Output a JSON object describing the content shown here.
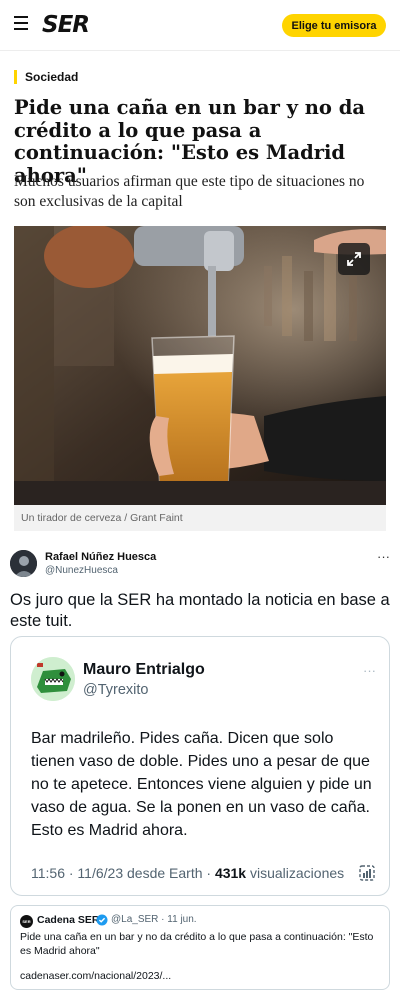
{
  "header": {
    "logo": "SER",
    "cta_label": "Elige tu emisora"
  },
  "article": {
    "section": "Sociedad",
    "headline": "Pide una caña en un bar y no da crédito a lo que pasa a continuación: \"Esto es Madrid ahora\"",
    "subhead": "Muchos usuarios afirman que este tipo de situaciones no son exclusivas de la capital",
    "caption": "Un tirador de cerveza / Grant Faint"
  },
  "tweet": {
    "author_name": "Rafael Núñez Huesca",
    "author_handle": "@NunezHuesca",
    "more_label": "···",
    "text": "Os juro que la SER ha montado la noticia en base a este tuit."
  },
  "quoted_tweet": {
    "author_name": "Mauro Entrialgo",
    "author_handle": "@Tyrexito",
    "more_label": "···",
    "text": "Bar madrileño. Pides caña. Dicen que solo tienen vaso de doble. Pides uno a pesar de que no te apetece. Entonces viene alguien y pide un vaso de agua. Se la ponen en un vaso de caña. Esto es Madrid ahora.",
    "meta_prefix": "11:56 · 11/6/23 desde Earth · ",
    "views_count": "431k",
    "views_label": " visualizaciones"
  },
  "link_card": {
    "avatar_text": "SER",
    "author_name": "Cadena SER",
    "author_handle": "@La_SER · 11 jun.",
    "text": "Pide una caña en un bar y no da crédito a lo que pasa a continuación: \"Esto es Madrid ahora\"",
    "url": "cadenaser.com/nacional/2023/..."
  },
  "icons": [
    "hamburger-icon",
    "expand-icon",
    "more-icon",
    "stats-icon",
    "verified-icon"
  ],
  "colors": {
    "brand_yellow": "#ffd400",
    "twitter_gray": "#536471",
    "verified_blue": "#1d9bf0",
    "border": "#cfd9de"
  }
}
